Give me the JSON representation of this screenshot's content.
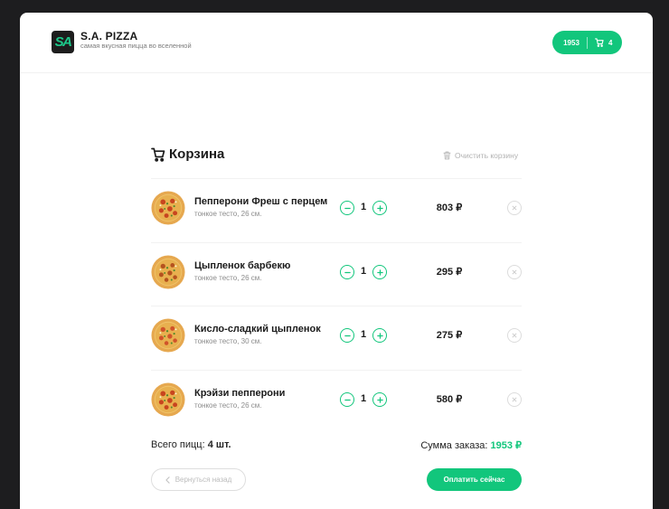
{
  "brand": {
    "logo_text": "SA",
    "title": "S.A. PIZZA",
    "subtitle": "самая вкусная пицца во вселенной"
  },
  "header_cart": {
    "sum": "1953",
    "count": "4"
  },
  "cart": {
    "title": "Корзина",
    "clear_label": "Очистить корзину",
    "items": [
      {
        "name": "Пепперони Фреш с перцем",
        "desc": "тонкое тесто, 26 см.",
        "qty": "1",
        "price": "803 ₽"
      },
      {
        "name": "Цыпленок барбекю",
        "desc": "тонкое тесто, 26 см.",
        "qty": "1",
        "price": "295 ₽"
      },
      {
        "name": "Кисло-сладкий цыпленок",
        "desc": "тонкое тесто, 30 см.",
        "qty": "1",
        "price": "275 ₽"
      },
      {
        "name": "Крэйзи пепперони",
        "desc": "тонкое тесто, 26 см.",
        "qty": "1",
        "price": "580 ₽"
      }
    ],
    "total_count_label": "Всего пицц:",
    "total_count_value": "4 шт.",
    "total_sum_label": "Сумма заказа:",
    "total_sum_value": "1953 ₽",
    "back_label": "Вернуться назад",
    "pay_label": "Оплатить сейчас"
  },
  "colors": {
    "accent": "#12c67c",
    "background": "#1d1d1f",
    "card": "#ffffff"
  }
}
